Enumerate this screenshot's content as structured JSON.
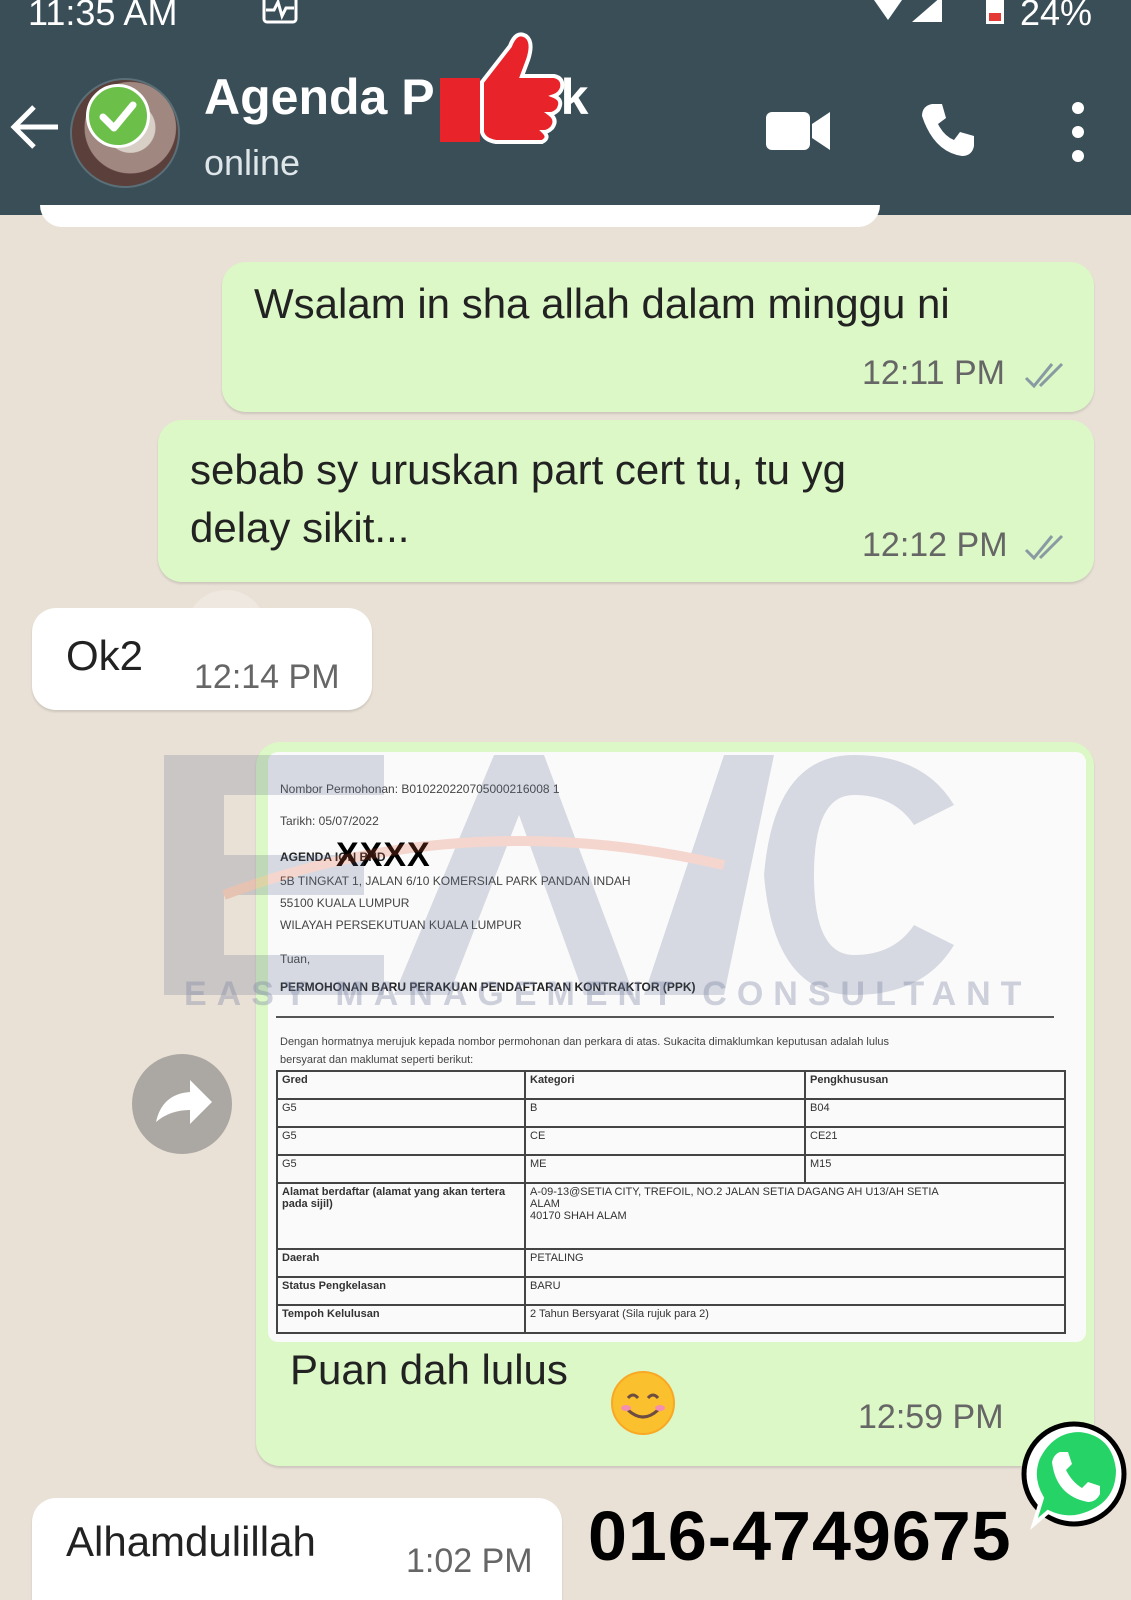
{
  "status_bar": {
    "time": "11:35 AM",
    "battery": "24%"
  },
  "header": {
    "contact_name": "Agenda P",
    "contact_name_tail": "k",
    "contact_status": "online",
    "icons": [
      "back-arrow-icon",
      "verified-check-icon",
      "thumbs-up-icon",
      "video-call-icon",
      "voice-call-icon",
      "more-vert-icon"
    ]
  },
  "messages": [
    {
      "direction": "out",
      "text": "Wsalam in sha allah dalam minggu ni",
      "time": "12:11 PM",
      "status": "read"
    },
    {
      "direction": "out",
      "text_line1": "sebab sy uruskan part cert tu, tu yg",
      "text_line2": "delay sikit...",
      "time": "12:12 PM",
      "status": "read"
    },
    {
      "direction": "in",
      "text": "Ok2",
      "time": "12:14 PM"
    },
    {
      "direction": "out",
      "caption": "Puan dah lulus",
      "time": "12:59 PM",
      "has_image": true
    },
    {
      "direction": "in",
      "text": "Alhamdulillah",
      "time": "1:02 PM"
    }
  ],
  "document": {
    "line1": "Nombor Permohonan: B010220220705000216008 1",
    "line2": "Tarikh:  05/07/2022",
    "line3": "AGENDA        ION  BHD",
    "redaction": "XXXX",
    "line4": "5B TINGKAT 1, JALAN 6/10 KOMERSIAL PARK PANDAN INDAH",
    "line5": "55100 KUALA LUMPUR",
    "line6": "WILAYAH PERSEKUTUAN KUALA LUMPUR",
    "line7": "Tuan,",
    "heading": "PERMOHONAN BARU PERAKUAN PENDAFTARAN KONTRAKTOR (PPK)",
    "para1": "Dengan hormatnya merujuk kepada nombor permohonan dan perkara di atas. Sukacita dimaklumkan keputusan adalah lulus",
    "para2": "bersyarat dan maklumat seperti berikut:",
    "table": {
      "headers": [
        "Gred",
        "Kategori",
        "Pengkhususan"
      ],
      "rows": [
        [
          "G5",
          "B",
          "B04"
        ],
        [
          "G5",
          "CE",
          "CE21"
        ],
        [
          "G5",
          "ME",
          "M15"
        ]
      ],
      "address_label": "Alamat berdaftar (alamat yang akan tertera pada sijil)",
      "address_value_1": "A-09-13@SETIA CITY, TREFOIL, NO.2 JALAN SETIA DAGANG AH U13/AH SETIA",
      "address_value_2": "ALAM",
      "address_value_3": "40170 SHAH ALAM",
      "daerah_label": "Daerah",
      "daerah_value": "PETALING",
      "status_label": "Status Pengkelasan",
      "status_value": "BARU",
      "tempoh_label": "Tempoh Kelulusan",
      "tempoh_value": "2 Tahun Bersyarat      (Sila rujuk para 2)"
    }
  },
  "watermark": {
    "text": "EASY MANAGEMENT CONSULTANT"
  },
  "overlay": {
    "phone": "016-4749675"
  },
  "colors": {
    "header_bg": "#3a4e58",
    "outgoing_bubble": "#dcf8c6",
    "incoming_bubble": "#ffffff",
    "chat_bg": "#e9e1d6",
    "read_ticks": "#8a9aa3",
    "whatsapp_green": "#25d366",
    "thumbs_red": "#e8242a"
  }
}
